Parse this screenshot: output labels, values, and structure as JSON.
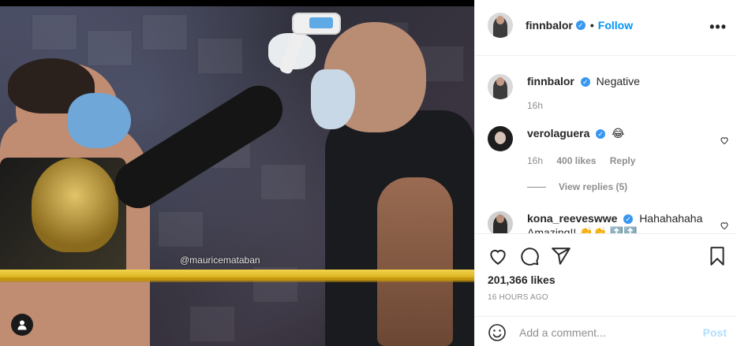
{
  "post": {
    "author": "finnbalor",
    "follow_label": "Follow",
    "separator": "•",
    "more_label": "•••",
    "image_watermark": "@mauricemataban"
  },
  "comments": [
    {
      "user": "finnbalor",
      "text": "Negative",
      "time": "16h",
      "likes": "",
      "reply": "",
      "has_heart": false
    },
    {
      "user": "verolaguera",
      "text": "😂",
      "time": "16h",
      "likes": "400 likes",
      "reply": "Reply",
      "has_heart": true
    },
    {
      "user": "kona_reeveswwe",
      "text": "Hahahahaha Amazing!! 👏👏 🔝🔝",
      "time": "",
      "likes": "",
      "reply": "",
      "has_heart": true
    }
  ],
  "view_replies": "View replies (5)",
  "likes_count": "201,366 likes",
  "post_time": "16 HOURS AGO",
  "composer": {
    "placeholder": "Add a comment...",
    "post_label": "Post"
  },
  "colors": {
    "accent": "#0095f6",
    "verified": "#3897f0",
    "muted": "#8e8e8e",
    "post_disabled": "#b2dffc"
  },
  "icons": [
    "heart-icon",
    "comment-icon",
    "share-icon",
    "bookmark-icon",
    "emoji-icon",
    "more-icon",
    "verified-icon",
    "user-tag-icon"
  ]
}
